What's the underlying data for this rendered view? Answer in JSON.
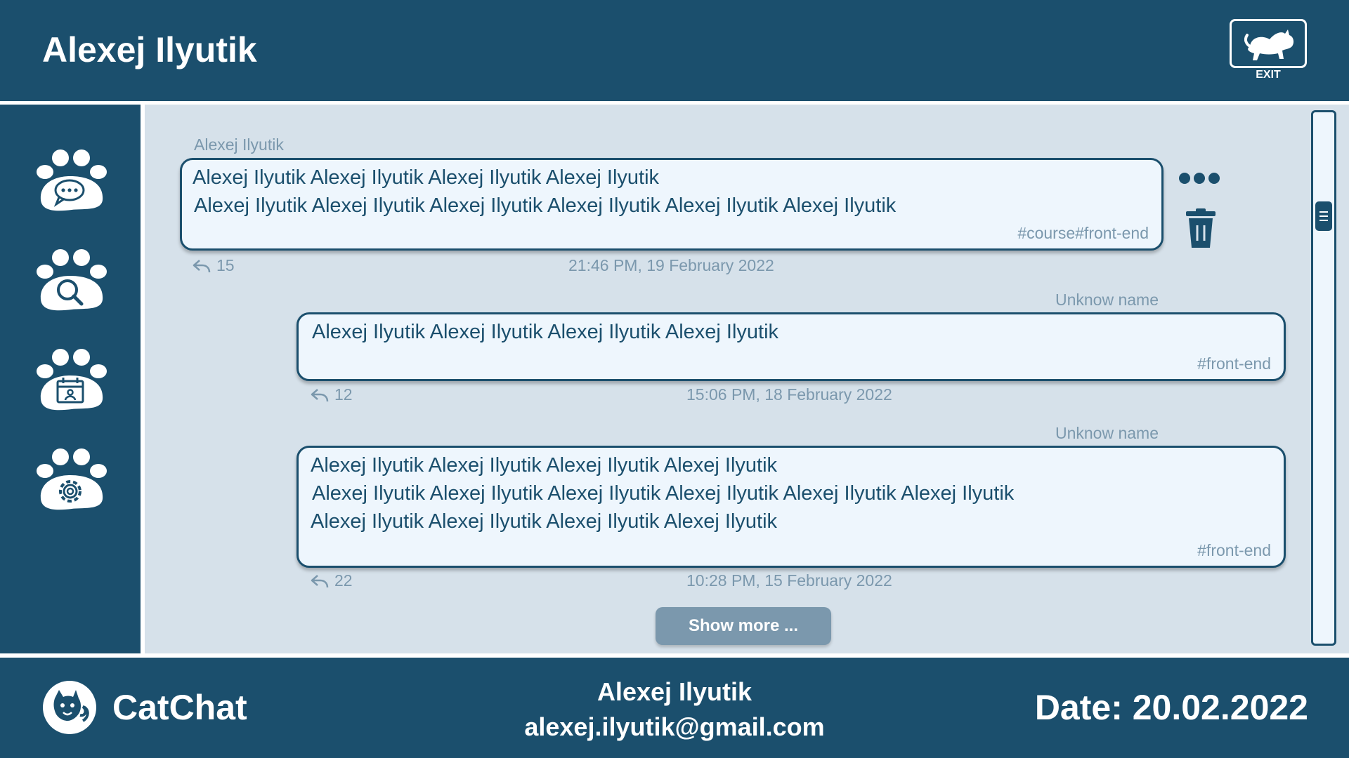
{
  "header": {
    "title": "Alexej Ilyutik",
    "exit_label": "EXIT"
  },
  "sidebar": {
    "items": [
      {
        "name": "chat",
        "icon": "paw-chat-icon"
      },
      {
        "name": "search",
        "icon": "paw-search-icon"
      },
      {
        "name": "calendar",
        "icon": "paw-calendar-icon"
      },
      {
        "name": "settings",
        "icon": "paw-settings-icon"
      }
    ]
  },
  "messages": [
    {
      "author": "Alexej Ilyutik",
      "lines": [
        "Alexej Ilyutik Alexej Ilyutik Alexej Ilyutik Alexej Ilyutik",
        "Alexej Ilyutik Alexej Ilyutik Alexej Ilyutik Alexej Ilyutik Alexej Ilyutik Alexej Ilyutik"
      ],
      "tags": "#course#front-end",
      "replies": "15",
      "timestamp": "21:46 PM, 19 February 2022"
    },
    {
      "author": "Unknow name",
      "lines": [
        "Alexej Ilyutik Alexej Ilyutik Alexej Ilyutik Alexej Ilyutik"
      ],
      "tags": "#front-end",
      "replies": "12",
      "timestamp": "15:06 PM, 18 February 2022"
    },
    {
      "author": "Unknow name",
      "lines": [
        "Alexej Ilyutik Alexej Ilyutik Alexej Ilyutik Alexej Ilyutik",
        "Alexej Ilyutik Alexej Ilyutik Alexej Ilyutik Alexej Ilyutik Alexej Ilyutik Alexej Ilyutik",
        "Alexej Ilyutik Alexej Ilyutik Alexej Ilyutik Alexej Ilyutik"
      ],
      "tags": "#front-end",
      "replies": "22",
      "timestamp": "10:28 PM, 15 February 2022"
    }
  ],
  "show_more_label": "Show more ...",
  "footer": {
    "brand": "CatChat",
    "user_name": "Alexej Ilyutik",
    "user_email": "alexej.ilyutik@gmail.com",
    "date": "Date: 20.02.2022"
  },
  "colors": {
    "primary": "#1b4f6d",
    "background": "#d6e1ea",
    "bubble": "#eef6fd",
    "muted": "#7b98ad"
  }
}
